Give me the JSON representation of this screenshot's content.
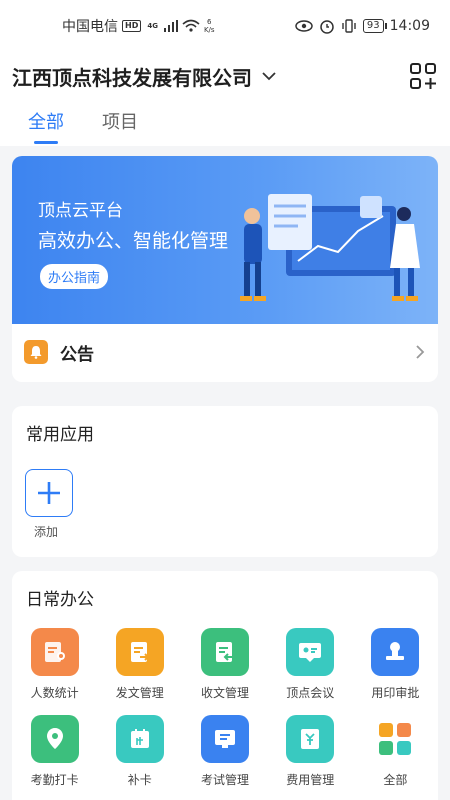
{
  "status": {
    "carrier": "中国电信",
    "hd": "HD",
    "net": "4G",
    "speed_value": "6",
    "speed_unit": "K/s",
    "battery": "93",
    "time": "14:09"
  },
  "header": {
    "company": "江西顶点科技发展有限公司"
  },
  "tabs": [
    {
      "label": "全部"
    },
    {
      "label": "项目"
    }
  ],
  "banner": {
    "line1": "顶点云平台",
    "line2": "高效办公、智能化管理",
    "guide": "办公指南"
  },
  "notice": {
    "label": "公告"
  },
  "common": {
    "title": "常用应用",
    "add_label": "添加"
  },
  "daily": {
    "title": "日常办公",
    "apps": [
      {
        "label": "人数统计",
        "icon": "stats-icon",
        "color": "#f4894a"
      },
      {
        "label": "发文管理",
        "icon": "send-doc-icon",
        "color": "#f5a524"
      },
      {
        "label": "收文管理",
        "icon": "receive-doc-icon",
        "color": "#3cbf7d"
      },
      {
        "label": "顶点会议",
        "icon": "meeting-icon",
        "color": "#39c9c0"
      },
      {
        "label": "用印审批",
        "icon": "seal-icon",
        "color": "#3a82f0"
      },
      {
        "label": "考勤打卡",
        "icon": "location-icon",
        "color": "#3cbf7d"
      },
      {
        "label": "补卡",
        "icon": "calendar-icon",
        "color": "#39c9c0"
      },
      {
        "label": "考试管理",
        "icon": "exam-icon",
        "color": "#3a82f0"
      },
      {
        "label": "费用管理",
        "icon": "expense-icon",
        "color": "#39c9c0"
      },
      {
        "label": "全部",
        "icon": "all-apps-icon",
        "color": "#ffffff"
      }
    ]
  }
}
